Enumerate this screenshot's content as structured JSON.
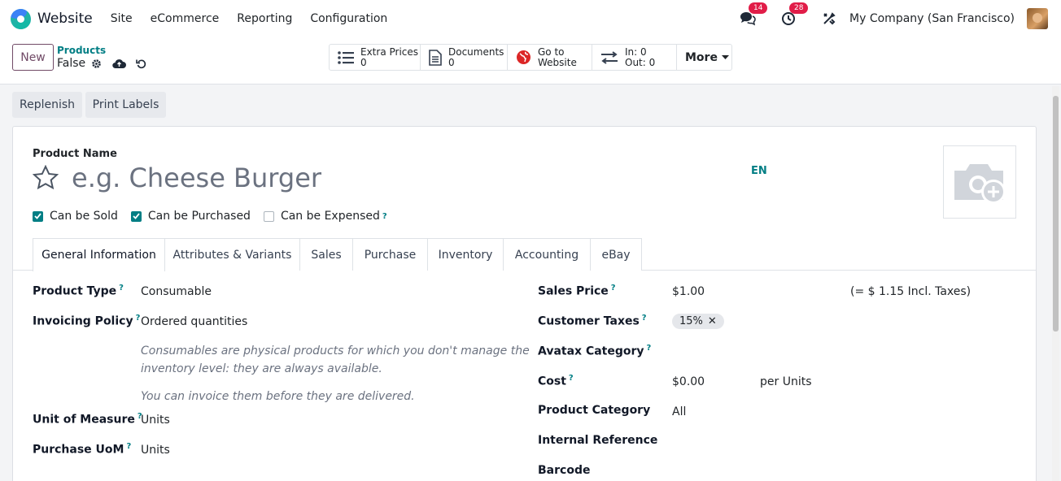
{
  "nav": {
    "app_name": "Website",
    "menu": [
      "Site",
      "eCommerce",
      "Reporting",
      "Configuration"
    ],
    "messages_count": "14",
    "activities_count": "28",
    "company": "My Company (San Francisco)"
  },
  "control": {
    "new_label": "New",
    "breadcrumb_parent": "Products",
    "breadcrumb_current": "False",
    "smart_buttons": [
      {
        "icon": "list-icon",
        "title": "Extra Prices",
        "value": "0"
      },
      {
        "icon": "document-icon",
        "title": "Documents",
        "value": "0"
      },
      {
        "icon": "globe-icon",
        "title": "Go to",
        "value": "Website"
      },
      {
        "icon": "exchange-icon",
        "title": "In: 0",
        "value": "Out: 0"
      }
    ],
    "more_label": "More"
  },
  "actions": {
    "replenish": "Replenish",
    "print_labels": "Print Labels"
  },
  "form": {
    "product_name_label": "Product Name",
    "product_name_placeholder": "e.g. Cheese Burger",
    "lang": "EN",
    "can_be_sold": "Can be Sold",
    "can_be_purchased": "Can be Purchased",
    "can_be_expensed": "Can be Expensed",
    "help_mark": "?"
  },
  "tabs": [
    "General Information",
    "Attributes & Variants",
    "Sales",
    "Purchase",
    "Inventory",
    "Accounting",
    "eBay"
  ],
  "general": {
    "product_type_label": "Product Type",
    "product_type": "Consumable",
    "invoicing_policy_label": "Invoicing Policy",
    "invoicing_policy": "Ordered quantities",
    "help_line1": "Consumables are physical products for which you don't manage the",
    "help_line2": "inventory level: they are always available.",
    "help_line3": "You can invoice them before they are delivered.",
    "uom_label": "Unit of Measure",
    "uom": "Units",
    "purchase_uom_label": "Purchase UoM",
    "purchase_uom": "Units",
    "sales_price_label": "Sales Price",
    "sales_price": "$1.00",
    "incl_taxes": "(= $ 1.15 Incl. Taxes)",
    "customer_taxes_label": "Customer Taxes",
    "tax_tag": "15%",
    "avatax_label": "Avatax Category",
    "cost_label": "Cost",
    "cost": "$0.00",
    "per_units": "per Units",
    "category_label": "Product Category",
    "category": "All",
    "internal_ref_label": "Internal Reference",
    "barcode_label": "Barcode"
  },
  "colors": {
    "primary": "#714b67",
    "teal": "#017e84",
    "badge": "#e11d48"
  }
}
